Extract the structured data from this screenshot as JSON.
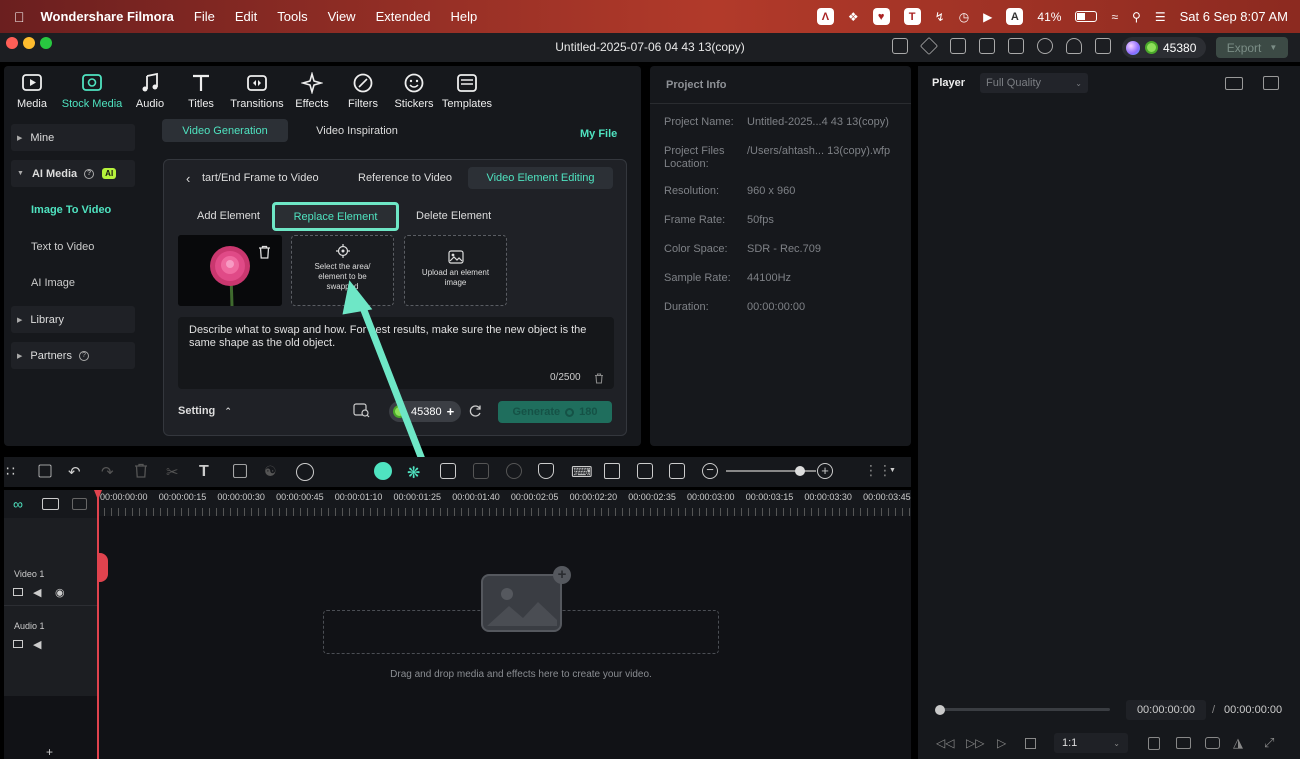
{
  "menubar": {
    "app": "Wondershare Filmora",
    "items": [
      "File",
      "Edit",
      "Tools",
      "View",
      "Extended",
      "Help"
    ],
    "battery": "41%",
    "datetime": "Sat 6 Sep  8:07 AM",
    "icon_letters": [
      "T",
      "A"
    ]
  },
  "window": {
    "title": "Untitled-2025-07-06 04 43 13(copy)",
    "credits": "45380",
    "export": "Export"
  },
  "toolbar": {
    "items": [
      {
        "label": "Media",
        "icon": "media-icon"
      },
      {
        "label": "Stock Media",
        "icon": "stock-media-icon",
        "active": true
      },
      {
        "label": "Audio",
        "icon": "music-note-icon"
      },
      {
        "label": "Titles",
        "icon": "text-t-icon"
      },
      {
        "label": "Transitions",
        "icon": "transitions-icon"
      },
      {
        "label": "Effects",
        "icon": "effects-icon"
      },
      {
        "label": "Filters",
        "icon": "filters-icon"
      },
      {
        "label": "Stickers",
        "icon": "stickers-icon"
      },
      {
        "label": "Templates",
        "icon": "templates-icon"
      }
    ]
  },
  "sidebar": {
    "mine": "Mine",
    "ai_media": "AI Media",
    "ai_badge": "AI",
    "sub_items": [
      "Image To Video",
      "Text to Video",
      "AI Image"
    ],
    "library": "Library",
    "partners": "Partners"
  },
  "gen": {
    "tabs": [
      "Video Generation",
      "Video Inspiration"
    ],
    "my_file": "My File",
    "modes": [
      "tart/End Frame to Video",
      "Reference to Video",
      "Video Element Editing"
    ],
    "actions": [
      "Add Element",
      "Replace Element",
      "Delete Element"
    ],
    "select_area": "Select the area/ element to be swapped",
    "upload": "Upload an element image",
    "prompt": "Describe what to swap and how. For best results, make sure the new object is the same shape as the old object.",
    "counter": "0/2500",
    "setting": "Setting",
    "credits": "45380",
    "generate": "Generate",
    "generate_cost": "180"
  },
  "info": {
    "title": "Project Info",
    "rows": [
      {
        "label": "Project Name:",
        "value": "Untitled-2025...4 43 13(copy)"
      },
      {
        "label": "Project Files Location:",
        "value": "/Users/ahtash... 13(copy).wfp"
      },
      {
        "label": "Resolution:",
        "value": "960 x 960"
      },
      {
        "label": "Frame Rate:",
        "value": "50fps"
      },
      {
        "label": "Color Space:",
        "value": "SDR - Rec.709"
      },
      {
        "label": "Sample Rate:",
        "value": "44100Hz"
      },
      {
        "label": "Duration:",
        "value": "00:00:00:00"
      }
    ]
  },
  "player": {
    "label": "Player",
    "quality": "Full Quality",
    "current": "00:00:00:00",
    "separator": "/",
    "total": "00:00:00:00",
    "ratio": "1:1"
  },
  "timeline": {
    "ticks": [
      "00:00:00:00",
      "00:00:00:15",
      "00:00:00:30",
      "00:00:00:45",
      "00:00:01:10",
      "00:00:01:25",
      "00:00:01:40",
      "00:00:02:05",
      "00:00:02:20",
      "00:00:02:35",
      "00:00:03:00",
      "00:00:03:15",
      "00:00:03:30",
      "00:00:03:45"
    ],
    "video_track": "Video 1",
    "audio_track": "Audio 1",
    "drop_hint": "Drag and drop media and effects here to create your video.",
    "zoom_level": 0.82
  },
  "colors": {
    "accent": "#4fe3c0",
    "highlight": "#6ee7c6",
    "playhead": "#e0434e"
  }
}
